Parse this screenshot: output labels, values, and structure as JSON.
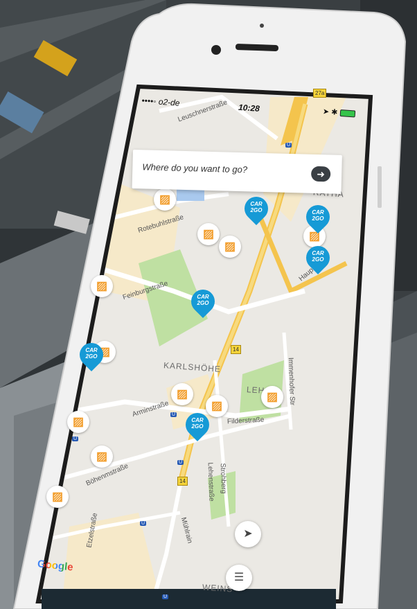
{
  "status_bar": {
    "carrier": "••••◦ o2-de",
    "time": "10:28",
    "icons": "➤ ✱"
  },
  "search": {
    "placeholder": "Where do you want to go?",
    "button_icon": "arrow-right-icon"
  },
  "map": {
    "provider": "Google",
    "labels": {
      "leuschnerstrasse": "Leuschnerstraße",
      "rotebuhlstrasse": "Rotebuhlstraße",
      "feinburgstrasse": "Feinburgstraße",
      "karlshohe": "KARLSHÖHE",
      "arminstrasse": "Arminstraße",
      "filderstrasse": "Filderstraße",
      "bohemstrasse": "Böhenmstraße",
      "lehenstrasse": "Lehenstraße",
      "strohberg": "Strohberg",
      "immenhofer": "Immenhofer Str",
      "mihlrain": "Mühlrain",
      "etzelstrasse": "Etzelstraße",
      "rathaus": "RATHA",
      "lehen": "LEH",
      "weins": "WEINS",
      "haupt": "Haupt"
    },
    "road_number": "14",
    "road_number_top": "27a",
    "u_label": "U",
    "pin_text_1": "CAR",
    "pin_text_2": "2GO"
  },
  "controls": {
    "locate_icon": "navigation-arrow-icon",
    "filter_icon": "sliders-icon"
  },
  "colors": {
    "accent": "#169ad6",
    "bus": "#f29d2b",
    "map_bg": "#ebe9e4",
    "park": "#bfe0a2"
  }
}
